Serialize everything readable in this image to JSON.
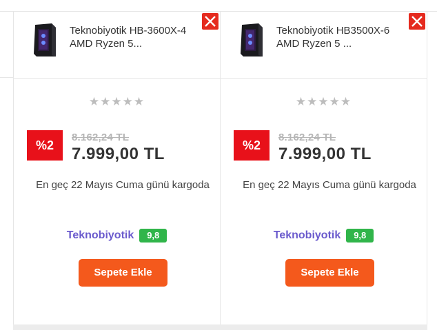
{
  "products": [
    {
      "title": "Teknobiyotik HB-3600X-4 AMD Ryzen 5...",
      "rating_stars": "★★★★★",
      "discount_badge": "%2",
      "old_price": "8.162,24 TL",
      "new_price": "7.999,00 TL",
      "delivery": "En geç 22 Mayıs Cuma günü kargoda",
      "seller": "Teknobiyotik",
      "seller_score": "9,8",
      "add_to_cart": "Sepete Ekle",
      "icon": "pc-case-image"
    },
    {
      "title": "Teknobiyotik HB3500X-6 AMD Ryzen 5 ...",
      "rating_stars": "★★★★★",
      "discount_badge": "%2",
      "old_price": "8.162,24 TL",
      "new_price": "7.999,00 TL",
      "delivery": "En geç 22 Mayıs Cuma günü kargoda",
      "seller": "Teknobiyotik",
      "seller_score": "9,8",
      "add_to_cart": "Sepete Ekle",
      "icon": "pc-case-image"
    }
  ],
  "colors": {
    "close": "#e52a1e",
    "discount": "#e8111a",
    "button": "#f4591c",
    "seller": "#6a5acd",
    "score": "#30b54a"
  }
}
